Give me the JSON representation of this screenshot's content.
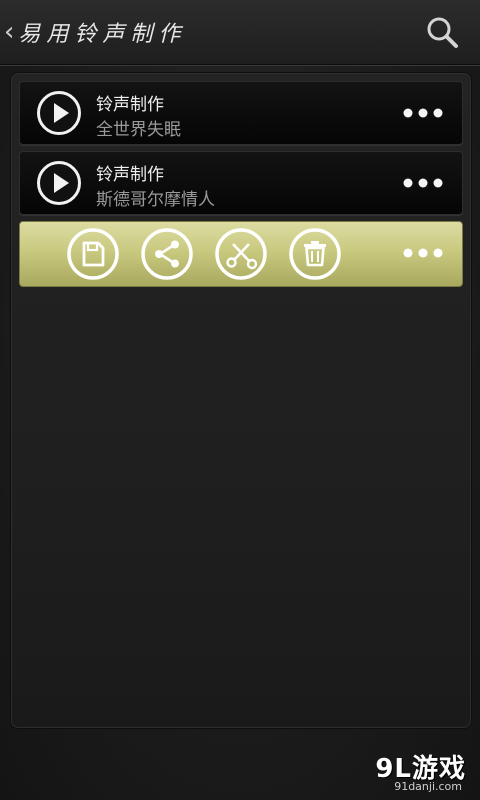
{
  "header": {
    "title": "易用铃声制作"
  },
  "list": {
    "items": [
      {
        "title": "铃声制作",
        "subtitle": "全世界失眠"
      },
      {
        "title": "铃声制作",
        "subtitle": "斯德哥尔摩情人"
      }
    ]
  },
  "action_bar": {
    "actions": [
      "save-icon",
      "share-icon",
      "scissors-icon",
      "trash-icon"
    ]
  },
  "watermark": {
    "logo": "9L游戏",
    "url": "91danji.com"
  },
  "colors": {
    "action_bar": "#c9c980",
    "row_bg": "#0a0a0a",
    "icon": "#ffffff"
  }
}
